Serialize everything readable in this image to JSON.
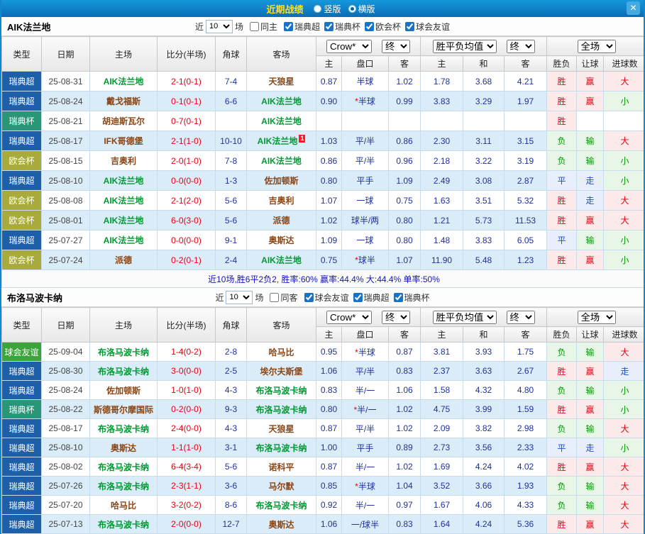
{
  "topbar": {
    "title": "近期战绩",
    "layout_options": [
      {
        "label": "竖版",
        "selected": false
      },
      {
        "label": "横版",
        "selected": true
      }
    ],
    "close_icon": "✕"
  },
  "shared_header": {
    "near": "近",
    "count": "10",
    "games": "场",
    "cols": {
      "type": "类型",
      "date": "日期",
      "home": "主场",
      "score": "比分(半场)",
      "corner": "角球",
      "away": "客场",
      "odds_group": "Crow*",
      "final": "终",
      "avg_group": "胜平负均值",
      "scope": "全场",
      "sub": [
        "主",
        "盘口",
        "客",
        "主",
        "和",
        "客",
        "胜负",
        "让球",
        "进球数"
      ]
    }
  },
  "league_colors": {
    "瑞典超": "#1d5fa8",
    "瑞典杯": "#2a9678",
    "欧会杯": "#a9aa3c",
    "球会友谊": "#3ba53b"
  },
  "team_colors": {
    "focus": "#009933",
    "opponent": "#8b4513"
  },
  "result_colors": {
    "red": "#e60012",
    "green": "#009900",
    "blue": "#1650c8"
  },
  "result_tints": {
    "red": "#fceaea",
    "green": "#e8f6e8",
    "blue": "#e8eefb"
  },
  "value_color_map": {
    "胜": "red",
    "赢": "red",
    "大": "red",
    "负": "green",
    "输": "green",
    "小": "green",
    "平": "blue",
    "走": "blue"
  },
  "sections": [
    {
      "team": "AIK法兰地",
      "same_filter": "同主",
      "leagues": [
        "瑞典超",
        "瑞典杯",
        "欧会杯",
        "球会友谊"
      ],
      "rows": [
        {
          "league": "瑞典超",
          "date": "25-08-31",
          "home": "AIK法兰地",
          "score": "2-1(0-1)",
          "corner": "7-4",
          "away": "天狼星",
          "o1": "0.87",
          "hcp": "半球",
          "o2": "1.02",
          "a1": "1.78",
          "a2": "3.68",
          "a3": "4.21",
          "r": "胜",
          "l": "赢",
          "g": "大"
        },
        {
          "league": "瑞典超",
          "date": "25-08-24",
          "home": "戴戈福斯",
          "score": "0-1(0-1)",
          "corner": "6-6",
          "away": "AIK法兰地",
          "o1": "0.90",
          "hcp": "*半球",
          "o2": "0.99",
          "a1": "3.83",
          "a2": "3.29",
          "a3": "1.97",
          "r": "胜",
          "l": "赢",
          "g": "小"
        },
        {
          "league": "瑞典杯",
          "date": "25-08-21",
          "home": "胡迪斯瓦尔",
          "score": "0-7(0-1)",
          "corner": "",
          "away": "AIK法兰地",
          "o1": "",
          "hcp": "",
          "o2": "",
          "a1": "",
          "a2": "",
          "a3": "",
          "r": "胜",
          "l": "",
          "g": ""
        },
        {
          "league": "瑞典超",
          "date": "25-08-17",
          "home": "IFK哥德堡",
          "score": "2-1(1-0)",
          "corner": "10-10",
          "away": "AIK法兰地",
          "away_badge": "1",
          "o1": "1.03",
          "hcp": "平/半",
          "o2": "0.86",
          "a1": "2.30",
          "a2": "3.11",
          "a3": "3.15",
          "r": "负",
          "l": "输",
          "g": "大"
        },
        {
          "league": "欧会杯",
          "date": "25-08-15",
          "home": "吉奥利",
          "score": "2-0(1-0)",
          "corner": "7-8",
          "away": "AIK法兰地",
          "o1": "0.86",
          "hcp": "平/半",
          "o2": "0.96",
          "a1": "2.18",
          "a2": "3.22",
          "a3": "3.19",
          "r": "负",
          "l": "输",
          "g": "小"
        },
        {
          "league": "瑞典超",
          "date": "25-08-10",
          "home": "AIK法兰地",
          "score": "0-0(0-0)",
          "corner": "1-3",
          "away": "佐加顿斯",
          "o1": "0.80",
          "hcp": "平手",
          "o2": "1.09",
          "a1": "2.49",
          "a2": "3.08",
          "a3": "2.87",
          "r": "平",
          "l": "走",
          "g": "小"
        },
        {
          "league": "欧会杯",
          "date": "25-08-08",
          "home": "AIK法兰地",
          "score": "2-1(2-0)",
          "corner": "5-6",
          "away": "吉奥利",
          "o1": "1.07",
          "hcp": "一球",
          "o2": "0.75",
          "a1": "1.63",
          "a2": "3.51",
          "a3": "5.32",
          "r": "胜",
          "l": "走",
          "g": "大"
        },
        {
          "league": "欧会杯",
          "date": "25-08-01",
          "home": "AIK法兰地",
          "score": "6-0(3-0)",
          "corner": "5-6",
          "away": "派德",
          "o1": "1.02",
          "hcp": "球半/两",
          "o2": "0.80",
          "a1": "1.21",
          "a2": "5.73",
          "a3": "11.53",
          "r": "胜",
          "l": "赢",
          "g": "大"
        },
        {
          "league": "瑞典超",
          "date": "25-07-27",
          "home": "AIK法兰地",
          "score": "0-0(0-0)",
          "corner": "9-1",
          "away": "奥斯达",
          "o1": "1.09",
          "hcp": "一球",
          "o2": "0.80",
          "a1": "1.48",
          "a2": "3.83",
          "a3": "6.05",
          "r": "平",
          "l": "输",
          "g": "小"
        },
        {
          "league": "欧会杯",
          "date": "25-07-24",
          "home": "派德",
          "score": "0-2(0-1)",
          "corner": "2-4",
          "away": "AIK法兰地",
          "o1": "0.75",
          "hcp": "*球半",
          "o2": "1.07",
          "a1": "11.90",
          "a2": "5.48",
          "a3": "1.23",
          "r": "胜",
          "l": "赢",
          "g": "小"
        }
      ],
      "summary": "近10场,胜6平2负2, 胜率:60% 赢率:44.4% 大:44.4% 单率:50%"
    },
    {
      "team": "布洛马波卡纳",
      "same_filter": "同客",
      "leagues": [
        "球会友谊",
        "瑞典超",
        "瑞典杯"
      ],
      "rows": [
        {
          "league": "球会友谊",
          "date": "25-09-04",
          "home": "布洛马波卡纳",
          "score": "1-4(0-2)",
          "corner": "2-8",
          "away": "哈马比",
          "o1": "0.95",
          "hcp": "*半球",
          "o2": "0.87",
          "a1": "3.81",
          "a2": "3.93",
          "a3": "1.75",
          "r": "负",
          "l": "输",
          "g": "大"
        },
        {
          "league": "瑞典超",
          "date": "25-08-30",
          "home": "布洛马波卡纳",
          "score": "3-0(0-0)",
          "corner": "2-5",
          "away": "埃尔夫斯堡",
          "o1": "1.06",
          "hcp": "平/半",
          "o2": "0.83",
          "a1": "2.37",
          "a2": "3.63",
          "a3": "2.67",
          "r": "胜",
          "l": "赢",
          "g": "走"
        },
        {
          "league": "瑞典超",
          "date": "25-08-24",
          "home": "佐加顿斯",
          "score": "1-0(1-0)",
          "corner": "4-3",
          "away": "布洛马波卡纳",
          "o1": "0.83",
          "hcp": "半/一",
          "o2": "1.06",
          "a1": "1.58",
          "a2": "4.32",
          "a3": "4.80",
          "r": "负",
          "l": "输",
          "g": "小"
        },
        {
          "league": "瑞典杯",
          "date": "25-08-22",
          "home": "斯德哥尔摩国际",
          "score": "0-2(0-0)",
          "corner": "9-3",
          "away": "布洛马波卡纳",
          "o1": "0.80",
          "hcp": "*半/一",
          "o2": "1.02",
          "a1": "4.75",
          "a2": "3.99",
          "a3": "1.59",
          "r": "胜",
          "l": "赢",
          "g": "小"
        },
        {
          "league": "瑞典超",
          "date": "25-08-17",
          "home": "布洛马波卡纳",
          "score": "2-4(0-0)",
          "corner": "4-3",
          "away": "天狼星",
          "o1": "0.87",
          "hcp": "平/半",
          "o2": "1.02",
          "a1": "2.09",
          "a2": "3.82",
          "a3": "2.98",
          "r": "负",
          "l": "输",
          "g": "大"
        },
        {
          "league": "瑞典超",
          "date": "25-08-10",
          "home": "奥斯达",
          "score": "1-1(1-0)",
          "corner": "3-1",
          "away": "布洛马波卡纳",
          "o1": "1.00",
          "hcp": "平手",
          "o2": "0.89",
          "a1": "2.73",
          "a2": "3.56",
          "a3": "2.33",
          "r": "平",
          "l": "走",
          "g": "小"
        },
        {
          "league": "瑞典超",
          "date": "25-08-02",
          "home": "布洛马波卡纳",
          "score": "6-4(3-4)",
          "corner": "5-6",
          "away": "诺科平",
          "o1": "0.87",
          "hcp": "半/一",
          "o2": "1.02",
          "a1": "1.69",
          "a2": "4.24",
          "a3": "4.02",
          "r": "胜",
          "l": "赢",
          "g": "大"
        },
        {
          "league": "瑞典超",
          "date": "25-07-26",
          "home": "布洛马波卡纳",
          "score": "2-3(1-1)",
          "corner": "3-6",
          "away": "马尔默",
          "o1": "0.85",
          "hcp": "*半球",
          "o2": "1.04",
          "a1": "3.52",
          "a2": "3.66",
          "a3": "1.93",
          "r": "负",
          "l": "输",
          "g": "大"
        },
        {
          "league": "瑞典超",
          "date": "25-07-20",
          "home": "哈马比",
          "score": "3-2(0-2)",
          "corner": "8-6",
          "away": "布洛马波卡纳",
          "o1": "0.92",
          "hcp": "半/一",
          "o2": "0.97",
          "a1": "1.67",
          "a2": "4.06",
          "a3": "4.33",
          "r": "负",
          "l": "输",
          "g": "大"
        },
        {
          "league": "瑞典超",
          "date": "25-07-13",
          "home": "布洛马波卡纳",
          "score": "2-0(0-0)",
          "corner": "12-7",
          "away": "奥斯达",
          "o1": "1.06",
          "hcp": "一/球半",
          "o2": "0.83",
          "a1": "1.64",
          "a2": "4.24",
          "a3": "5.36",
          "r": "胜",
          "l": "赢",
          "g": "大"
        }
      ]
    }
  ]
}
